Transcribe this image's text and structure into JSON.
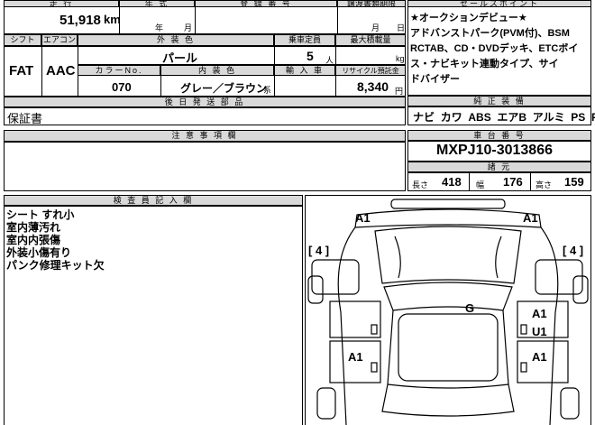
{
  "top_headers": {
    "mileage": "走 行",
    "year": "年 式",
    "reg_number": "登 録 番 号",
    "transfer_deadline": "譲渡書類期限",
    "sales_point": "セールスポイント"
  },
  "mileage": {
    "value": "51,918",
    "unit": "km"
  },
  "year_fields": {
    "year_unit": "年",
    "month_unit": "月"
  },
  "transfer_fields": {
    "month_unit": "月",
    "day_unit": "日"
  },
  "row2_headers": {
    "shift": "シフト",
    "aircon": "エアコン",
    "exterior_color": "外 装 色",
    "capacity": "乗車定員",
    "max_load": "最大積載量"
  },
  "shift": "FAT",
  "aircon": "AAC",
  "exterior_color": "パール",
  "capacity": {
    "value": "5",
    "unit": "人"
  },
  "max_load": {
    "value": "",
    "unit": "kg"
  },
  "row3_headers": {
    "color_no": "カラーNo.",
    "interior_color": "内 装 色",
    "import_year": "輸 入 車",
    "recycle_fee": "リサイクル預託金"
  },
  "color_no": "070",
  "interior_color": {
    "value": "グレー／ブラウン",
    "suffix": "系"
  },
  "recycle_fee": {
    "value": "8,340",
    "unit": "円"
  },
  "later_docs": {
    "header": "後 日 発 送 部 品",
    "content": "保証書"
  },
  "sales_point_text": [
    "★オークションデビュー★",
    "アドバンストパーク(PVM付)、BSM",
    "RCTAB、CD・DVDデッキ、ETCボイ",
    "ス・ナビキット連動タイプ、サイ",
    "ドバイザー"
  ],
  "equipment": {
    "header": "純 正 装 備",
    "items": [
      "ナビ",
      "カワ",
      "ABS",
      "エアB",
      "アルミ",
      "PS",
      "PW"
    ]
  },
  "notes": {
    "header": "注 意 事 項 欄",
    "content": ""
  },
  "chassis": {
    "header": "車 台 番 号",
    "number": "MXPJ10-3013866"
  },
  "dimensions": {
    "header": "諸 元",
    "length_label": "長さ",
    "length": "418",
    "width_label": "幅",
    "width": "176",
    "height_label": "高さ",
    "height": "159"
  },
  "inspector": {
    "header": "検 査 員 記 入 欄",
    "lines": [
      "シート すれ小",
      "室内薄汚れ",
      "室内内張傷",
      "外装小傷有り",
      "パンク修理キット欠"
    ]
  },
  "diagram": {
    "marks": {
      "a1_front_left": "A1",
      "a1_front_right": "A1",
      "four_left": "[ 4 ]",
      "four_right": "[ 4 ]",
      "g_roof": "G",
      "a1_right_door": "A1",
      "u1_right_door": "U1",
      "a1_left_rear": "A1",
      "a1_right_rear": "A1"
    }
  }
}
